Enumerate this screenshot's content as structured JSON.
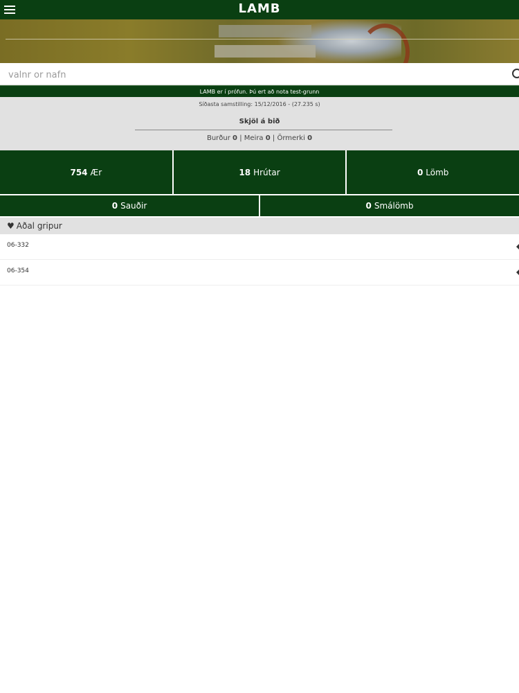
{
  "header": {
    "title": "LAMB",
    "menu_icon": "menu-icon"
  },
  "search": {
    "placeholder": "valnr or nafn",
    "icon": "search-icon"
  },
  "notice": {
    "text": "LAMB er í prófun. Þú ert að nota test-grunn"
  },
  "sync": {
    "last_sync": "Síðasta samstilling: 15/12/2016 - (27.235 s)",
    "documents_title": "Skjöl á bið",
    "counts": [
      {
        "label": "Burður",
        "value": "0"
      },
      {
        "label": "Meira",
        "value": "0"
      },
      {
        "label": "Örmerki",
        "value": "0"
      }
    ]
  },
  "stats": {
    "row1": [
      {
        "value": "754",
        "label": "Ær"
      },
      {
        "value": "18",
        "label": "Hrútar"
      },
      {
        "value": "0",
        "label": "Lömb"
      }
    ],
    "row2": [
      {
        "value": "0",
        "label": "Sauðir"
      },
      {
        "value": "0",
        "label": "Smálömb"
      }
    ]
  },
  "favorites": {
    "title": "Aðal gripur",
    "icon": "heart-icon",
    "items": [
      {
        "label": "06-332"
      },
      {
        "label": "06-354"
      }
    ]
  },
  "colors": {
    "brand_green": "#0a3f12",
    "panel_gray": "#e1e1e1"
  }
}
